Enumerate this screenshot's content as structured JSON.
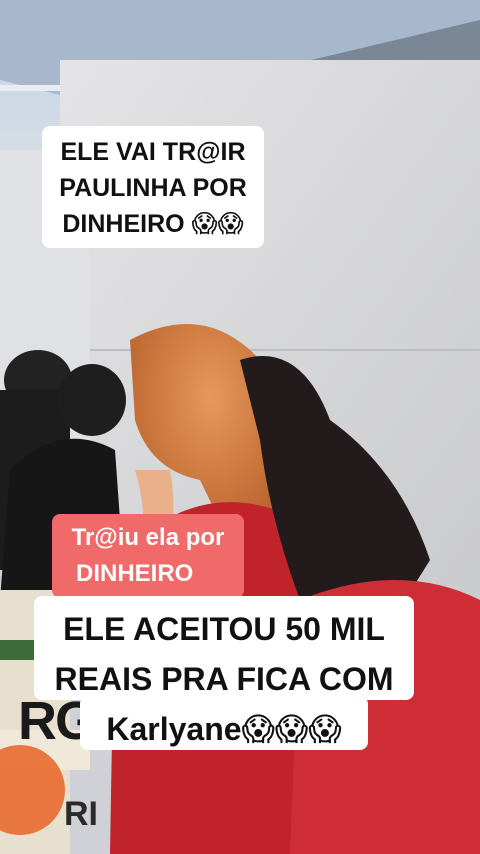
{
  "captions": {
    "top": {
      "line1": "ELE VAI TR@IR",
      "line2": "PAULINHA POR",
      "line3_text": "DINHEIRO",
      "line3_emoji": "😱😱"
    },
    "middle": {
      "line1": "Tr@iu ela por",
      "line2": "DINHEIRO",
      "bg_color": "#f06a6a",
      "text_color": "#ffffff"
    },
    "bottom": {
      "line1": "ELE ACEITOU 50 MIL",
      "line2": "REAIS PRA FICA COM",
      "line3_text": "Karlyane",
      "line3_emoji": "😱😱😱"
    }
  },
  "scene": {
    "description_icons": [
      "tent-canopy",
      "white-wall",
      "women-in-red"
    ],
    "sign_text_1": "RG",
    "sign_text_2": "RI"
  }
}
